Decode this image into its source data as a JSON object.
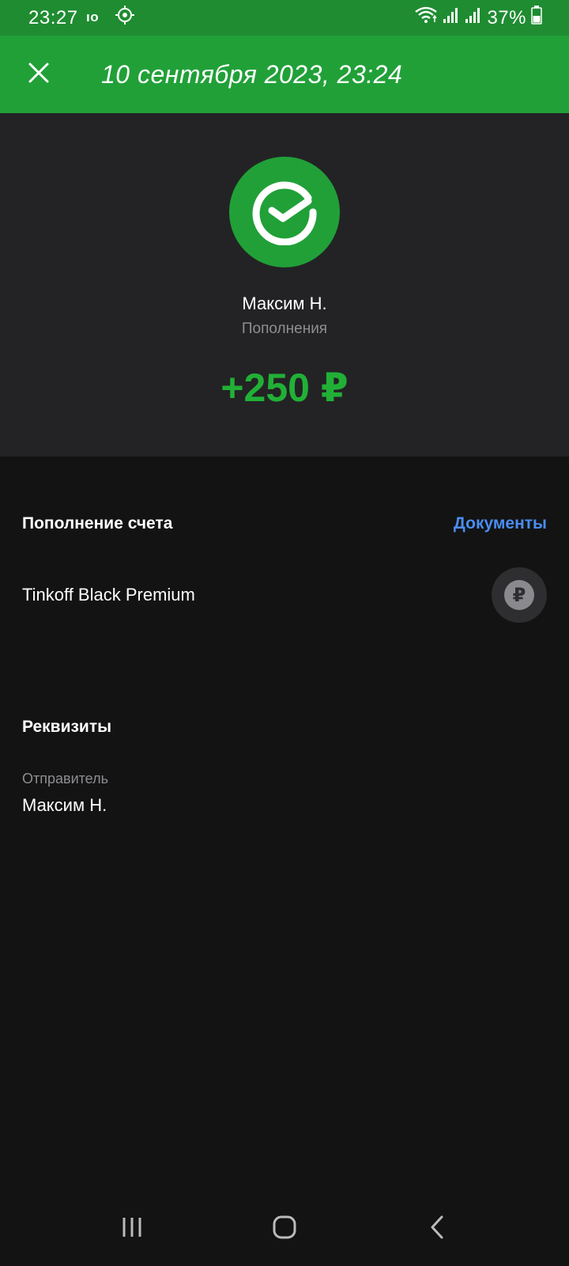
{
  "status_bar": {
    "time": "23:27",
    "battery": "37%",
    "icons": [
      "carrier-icon",
      "settings-notification-icon",
      "wifi-icon",
      "signal-icon",
      "signal-icon",
      "battery-icon"
    ]
  },
  "header": {
    "title": "10 сентября 2023, 23:24",
    "close_icon": "close-icon"
  },
  "summary": {
    "merchant_name": "Максим Н.",
    "category": "Пополнения",
    "amount": "+250 ₽",
    "logo_icon": "sber-logo-icon"
  },
  "operation": {
    "title": "Пополнение счета",
    "documents_link": "Документы",
    "account_name": "Tinkoff Black Premium",
    "account_icon": "ruble-coin-icon",
    "currency_symbol": "₽"
  },
  "details": {
    "title": "Реквизиты",
    "sender_label": "Отправитель",
    "sender_value": "Максим Н."
  },
  "colors": {
    "header_green": "#21a038",
    "status_green": "#1f8c31",
    "amount_green": "#21b036",
    "link_blue": "#4a8df0",
    "background": "#131313",
    "card_background": "#232325"
  },
  "nav": {
    "icons": [
      "recent-apps-icon",
      "home-icon",
      "back-icon"
    ]
  }
}
